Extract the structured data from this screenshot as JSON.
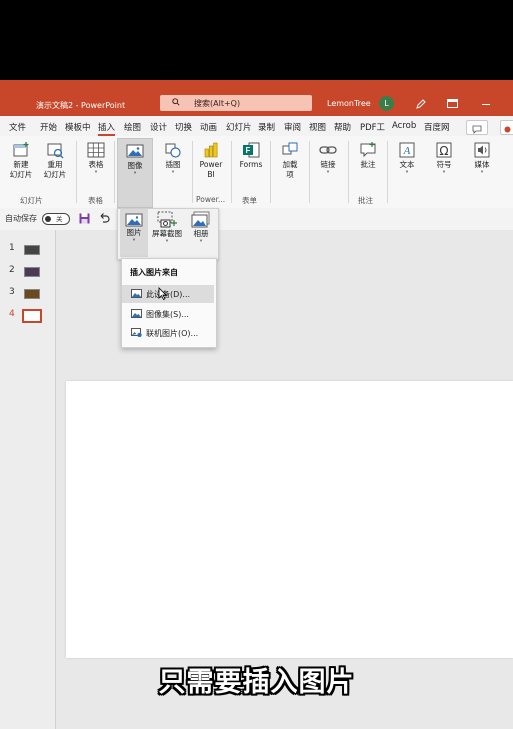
{
  "window": {
    "title": "演示文稿2 - PowerPoint",
    "search_text": "搜索(Alt+Q)",
    "user_name": "LemonTree",
    "avatar_initial": "L"
  },
  "tabs": [
    "文件",
    "开始",
    "模板中",
    "插入",
    "绘图",
    "设计",
    "切换",
    "动画",
    "幻灯片",
    "录制",
    "审阅",
    "视图",
    "帮助",
    "PDF工",
    "Acrob",
    "百度网"
  ],
  "active_tab": "插入",
  "ribbon": {
    "new_slide": [
      "新建",
      "幻灯片"
    ],
    "reuse_slide": [
      "重用",
      "幻灯片"
    ],
    "table": "表格",
    "image": "图像",
    "illustrations": "插图",
    "power_bi": [
      "Power",
      "BI"
    ],
    "forms": "Forms",
    "addins": [
      "加载",
      "项"
    ],
    "link": "链接",
    "comment": "批注",
    "text": "文本",
    "symbol": "符号",
    "media": "媒体",
    "groups": {
      "slides": "幻灯片",
      "tables": "表格",
      "power": "Power...",
      "forms": "表单",
      "comments": "批注"
    }
  },
  "qat": {
    "autosave_label": "自动保存",
    "autosave_state": "关"
  },
  "picture_submenu": {
    "pictures": "图片",
    "screenshot": "屏幕截图",
    "album": "相册"
  },
  "dropdown": {
    "header": "插入图片来自",
    "items": [
      "此设备(D)...",
      "图像集(S)...",
      "联机图片(O)..."
    ]
  },
  "slides": [
    "1",
    "2",
    "3",
    "4"
  ],
  "caption": "只需要插入图片",
  "colors": {
    "accent": "#c8472a",
    "avatar": "#3b7d4a"
  }
}
